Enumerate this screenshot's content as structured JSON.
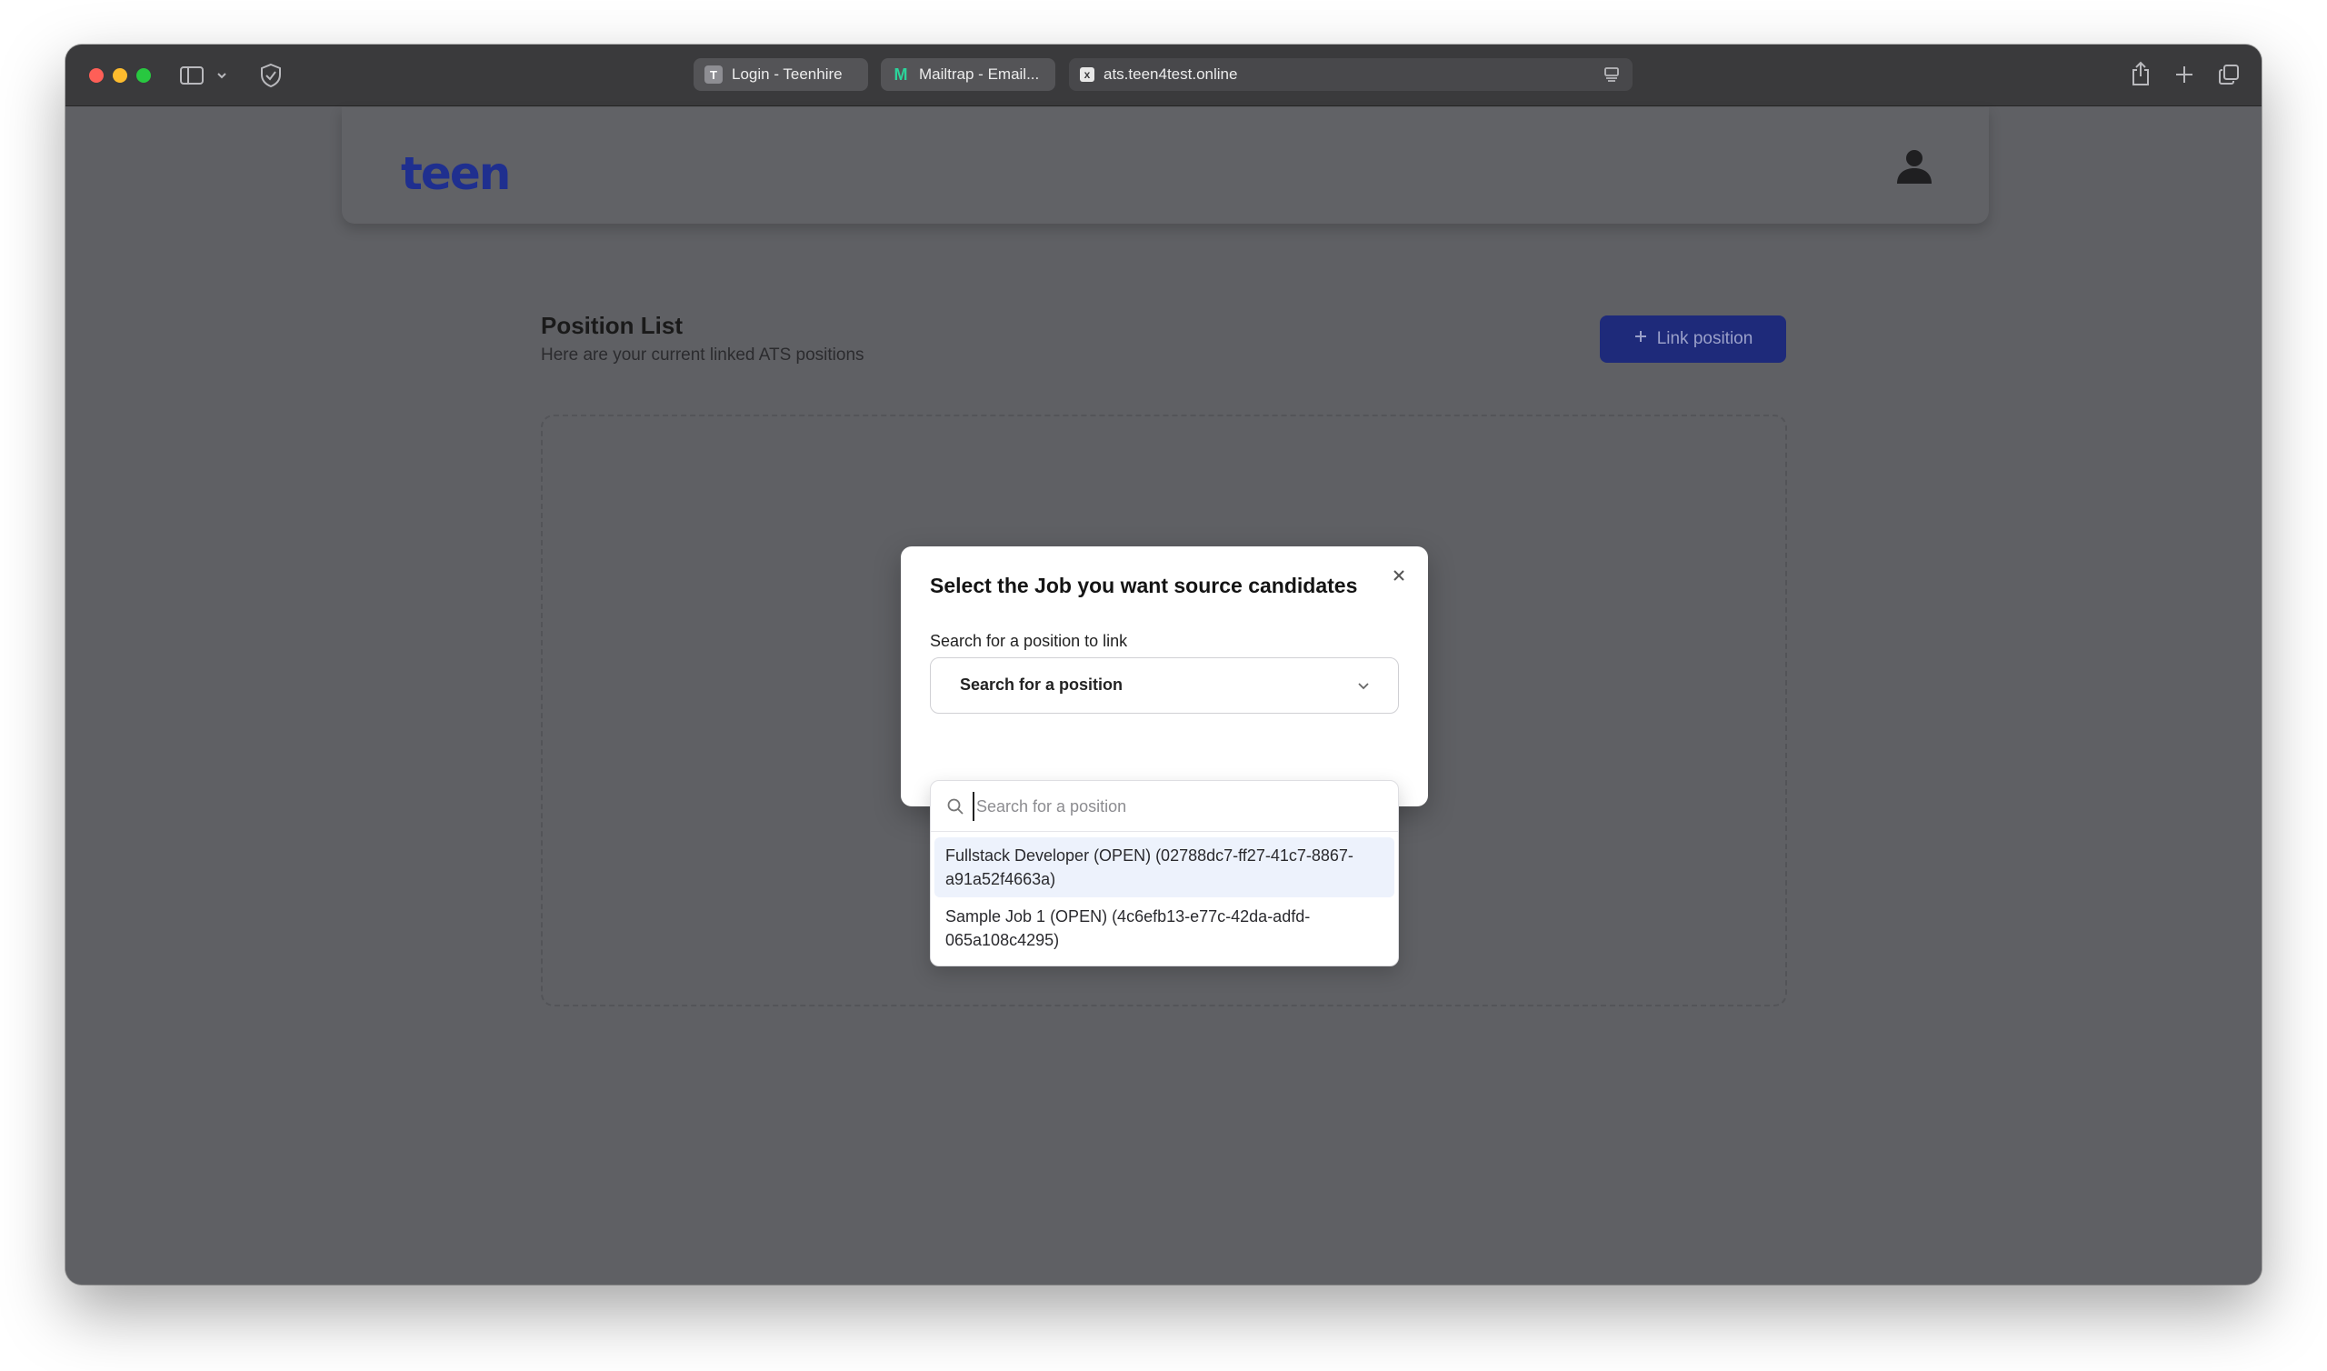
{
  "browser": {
    "tabs": [
      {
        "label": "Login - Teenhire",
        "favicon": "T"
      },
      {
        "label": "Mailtrap - Email...",
        "favicon": "M"
      },
      {
        "label": "ats.teen4test.online",
        "favicon": "x"
      }
    ],
    "icons": [
      "sidebar-icon",
      "chevron-down-icon",
      "shield-icon",
      "reader-icon",
      "share-icon",
      "new-tab-icon",
      "tab-overview-icon"
    ]
  },
  "header": {
    "logo": "teen"
  },
  "page": {
    "title": "Position List",
    "subtitle": "Here are your current linked ATS positions",
    "link_button": "Link position"
  },
  "modal": {
    "title": "Select the Job you want source candidates",
    "field_label": "Search for a position to link",
    "select_value": "Search for a position",
    "search_placeholder": "Search for a position",
    "options": [
      "Fullstack Developer (OPEN) (02788dc7-ff27-41c7-8867-a91a52f4663a)",
      "Sample Job 1 (OPEN) (4c6efb13-e77c-42da-adfd-065a108c4295)"
    ]
  },
  "colors": {
    "overlay": "#5f6064",
    "brand": "#1f2f8f",
    "button": "#1e2a7a",
    "highlight": "#edf2fc"
  }
}
